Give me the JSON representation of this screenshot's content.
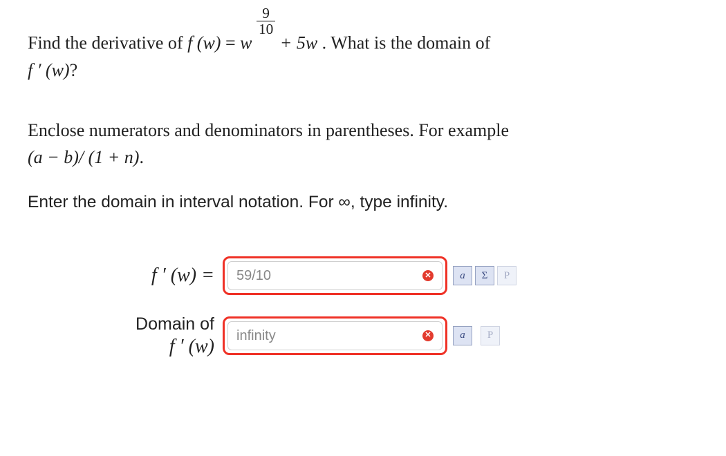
{
  "question": {
    "line_parts": {
      "p1": "Find  the  derivative  of  ",
      "f_of_w": "f (w)",
      "eq": " = ",
      "w": "w",
      "exp_num": "9",
      "exp_den": "10",
      "plus5w": " + 5w",
      "p2": ".  What  is  the  domain  of",
      "fprime_q": "f ′ (w)",
      "qmark": "?"
    }
  },
  "instruction1": {
    "text_a": "Enclose  numerators  and  denominators  in  parentheses.  For  example",
    "formula": "(a − b)/ (1 + n)",
    "period": "."
  },
  "instruction2": "Enter the domain in interval notation. For ∞, type infinity.",
  "answers": {
    "derivative": {
      "label_math": "f ′ (w) = ",
      "value": "59/10"
    },
    "domain": {
      "label_top": "Domain of",
      "label_math": "f ′ (w)",
      "value": "infinity"
    }
  },
  "icons": {
    "preview": "a",
    "sigma": "Σ",
    "page": "P"
  }
}
